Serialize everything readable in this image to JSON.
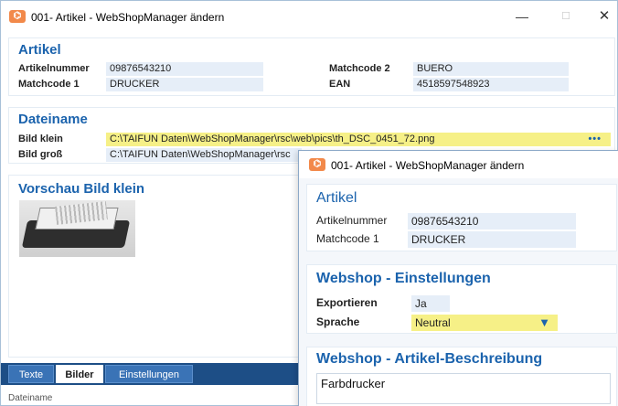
{
  "main_window": {
    "title": "001- Artikel - WebShopManager ändern",
    "controls": {
      "minimize": "—",
      "maximize": "☐",
      "close": "✕"
    },
    "artikel": {
      "heading": "Artikel",
      "artikelnummer_label": "Artikelnummer",
      "artikelnummer_value": "09876543210",
      "matchcode1_label": "Matchcode 1",
      "matchcode1_value": "DRUCKER",
      "matchcode2_label": "Matchcode 2",
      "matchcode2_value": "BUERO",
      "ean_label": "EAN",
      "ean_value": "4518597548923"
    },
    "dateiname": {
      "heading": "Dateiname",
      "bild_klein_label": "Bild klein",
      "bild_klein_value": "C:\\TAIFUN Daten\\WebShopManager\\rsc\\web\\pics\\th_DSC_0451_72.png",
      "bild_gross_label": "Bild groß",
      "bild_gross_value": "C:\\TAIFUN Daten\\WebShopManager\\rsc",
      "browse_label": "•••"
    },
    "vorschau": {
      "heading": "Vorschau Bild klein"
    },
    "tabs": [
      "Texte",
      "Bilder",
      "Einstellungen"
    ],
    "active_tab": "Bilder",
    "status": "Dateiname"
  },
  "overlay_window": {
    "title": "001- Artikel - WebShopManager ändern",
    "artikel": {
      "heading": "Artikel",
      "artikelnummer_label": "Artikelnummer",
      "artikelnummer_value": "09876543210",
      "matchcode1_label": "Matchcode 1",
      "matchcode1_value": "DRUCKER"
    },
    "webshop_einstellungen": {
      "heading": "Webshop - Einstellungen",
      "exportieren_label": "Exportieren",
      "exportieren_value": "Ja",
      "sprache_label": "Sprache",
      "sprache_value": "Neutral"
    },
    "beschreibung": {
      "heading": "Webshop - Artikel-Beschreibung",
      "text": "Farbdrucker"
    }
  },
  "colors": {
    "accent": "#1b63ad",
    "field": "#e6eef8",
    "highlight": "#f6f087",
    "tabbar": "#1d4e86"
  }
}
